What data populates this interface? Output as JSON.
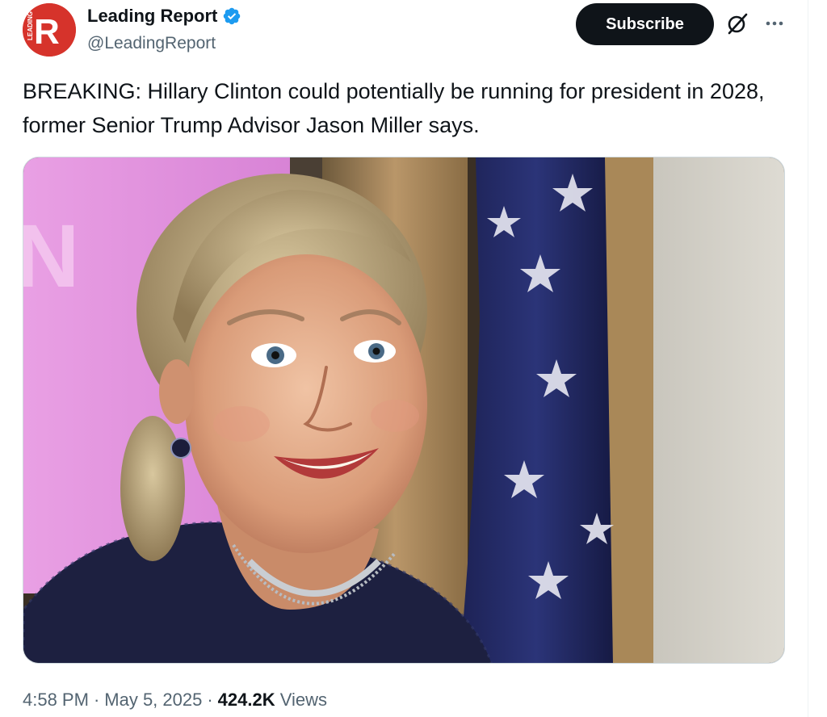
{
  "author": {
    "display_name": "Leading Report",
    "handle": "@LeadingReport",
    "avatar_letter": "R",
    "avatar_side_text": "LEADING",
    "verified": true,
    "brand_color": "#d6332b",
    "verified_color": "#1d9bf0"
  },
  "actions": {
    "subscribe_label": "Subscribe",
    "grok_icon": "grok-icon",
    "more_icon": "more-icon"
  },
  "tweet": {
    "text": "BREAKING: Hillary Clinton could potentially be running for president in 2028, former Senior Trump Advisor Jason Miller says.",
    "media_alt": "Photo of a smiling woman in front of a pink backdrop and an American flag"
  },
  "meta": {
    "time": "4:58 PM",
    "date": "May 5, 2025",
    "separator": "·",
    "views_count": "424.2K",
    "views_label": "Views"
  }
}
